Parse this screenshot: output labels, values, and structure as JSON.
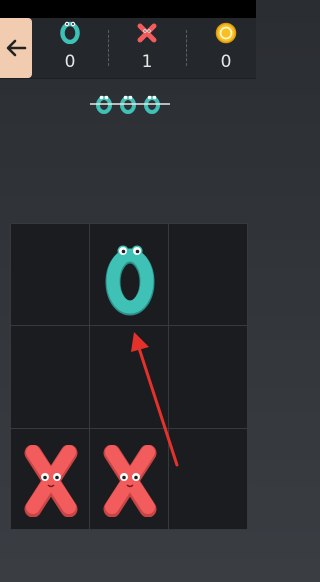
{
  "scores": {
    "o_count": "0",
    "x_count": "1",
    "coin_count": "0"
  },
  "board": {
    "cells": [
      "",
      "O",
      "",
      "",
      "",
      "",
      "X",
      "X",
      ""
    ]
  },
  "colors": {
    "o_color": "#3fc1b6",
    "x_color": "#f25c5c",
    "coin_color": "#f6c024",
    "annotation_arrow": "#e5312b"
  },
  "icons": {
    "back": "arrow-left-icon",
    "o": "o-piece-icon",
    "x": "x-piece-icon",
    "coin": "coin-icon",
    "win_pattern": "three-o-strikethrough-icon"
  }
}
